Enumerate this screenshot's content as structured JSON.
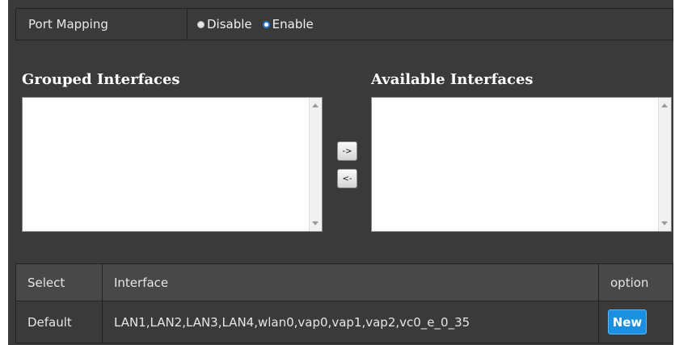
{
  "port_mapping": {
    "label": "Port Mapping",
    "options": [
      {
        "label": "Disable",
        "selected": false
      },
      {
        "label": "Enable",
        "selected": true
      }
    ]
  },
  "grouped": {
    "title": "Grouped Interfaces",
    "items": []
  },
  "available": {
    "title": "Available Interfaces",
    "items": []
  },
  "buttons": {
    "move_right": "->",
    "move_left": "<-"
  },
  "table": {
    "headers": {
      "select": "Select",
      "interface": "Interface",
      "option": "option"
    },
    "rows": [
      {
        "select": "Default",
        "interface": "LAN1,LAN2,LAN3,LAN4,wlan0,vap0,vap1,vap2,vc0_e_0_35",
        "action": "New"
      }
    ]
  },
  "colors": {
    "accent": "#1b8fe0",
    "panel": "#3a3a3a",
    "header_row": "#484848"
  }
}
